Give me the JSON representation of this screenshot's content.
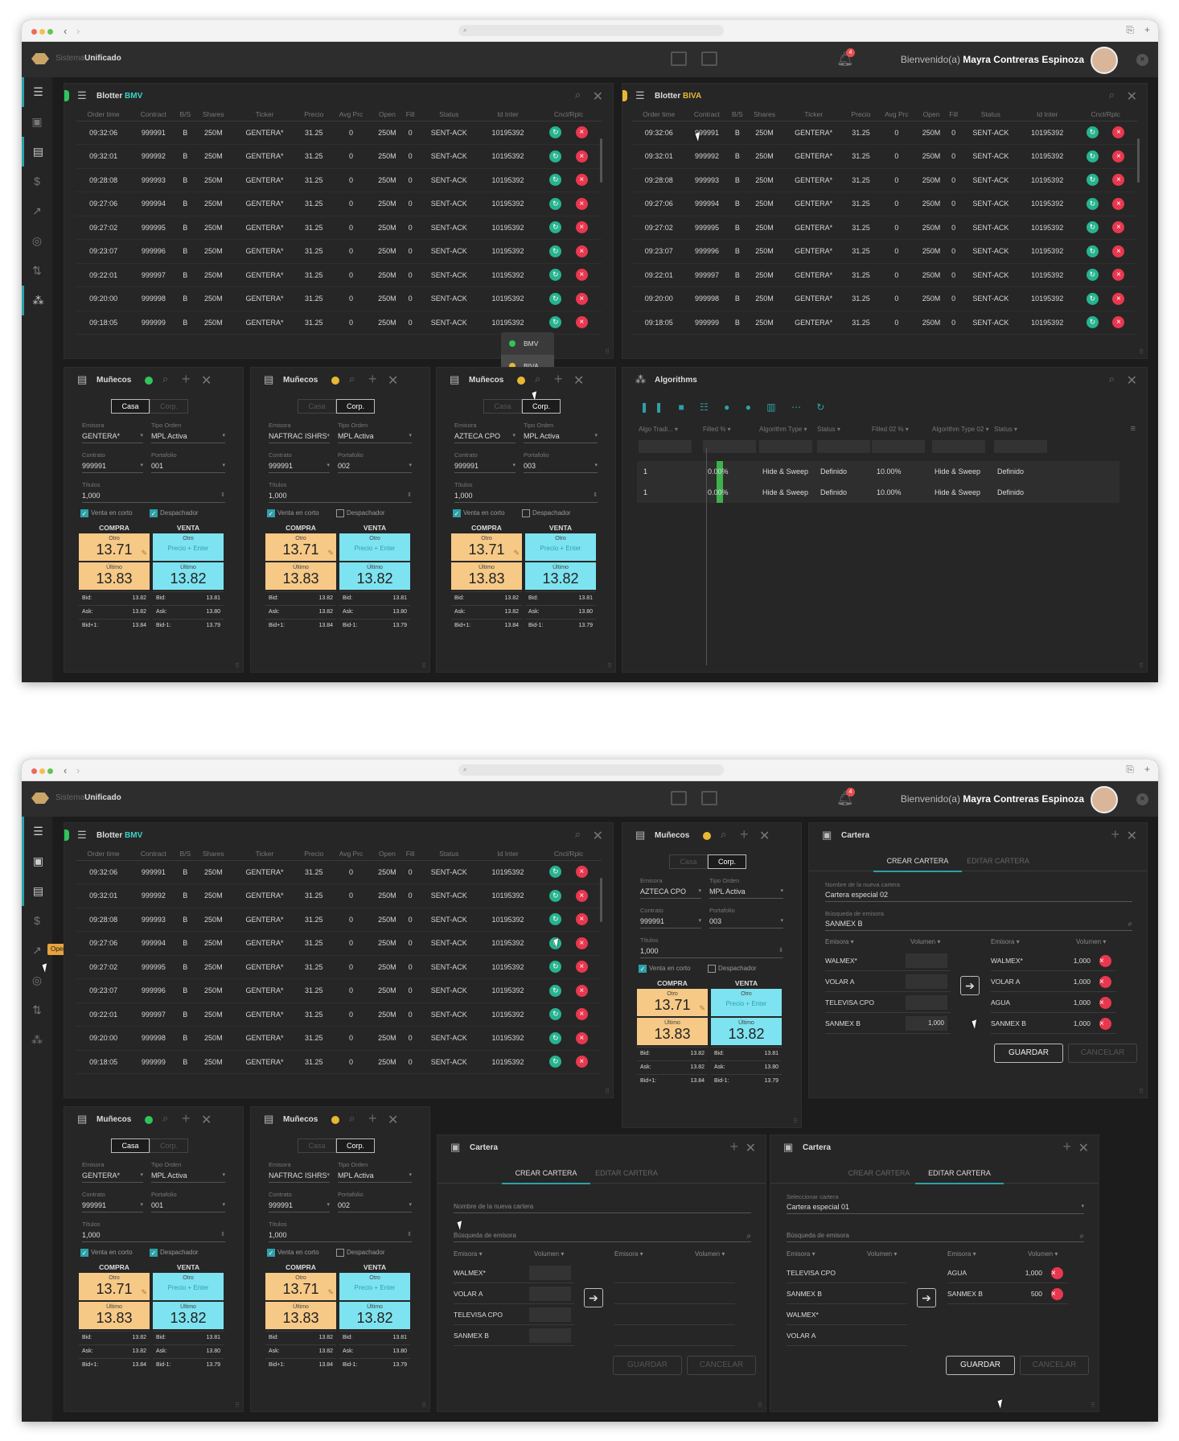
{
  "browser": {
    "back": "‹",
    "fwd": "›"
  },
  "app": {
    "brand_light": "Sistema",
    "brand_bold": "Unificado",
    "welcome": "Bienvenido(a)",
    "user": "Mayra Contreras Espinoza",
    "notif_count": "4"
  },
  "blotter": {
    "bmv_title": "Blotter",
    "bmv_tag": "BMV",
    "biva_title": "Blotter",
    "biva_tag": "BIVA",
    "cols": [
      "Order time",
      "Contract",
      "B/S",
      "Shares",
      "Ticker",
      "Precio",
      "Avg Prc",
      "Open",
      "Fill",
      "Status",
      "Id Inter",
      "Cncl/Rplc"
    ],
    "rows": [
      [
        "09:32:06",
        "999991",
        "B",
        "250M",
        "GENTERA*",
        "31.25",
        "0",
        "250M",
        "0",
        "SENT-ACK",
        "10195392"
      ],
      [
        "09:32:01",
        "999992",
        "B",
        "250M",
        "GENTERA*",
        "31.25",
        "0",
        "250M",
        "0",
        "SENT-ACK",
        "10195392"
      ],
      [
        "09:28:08",
        "999993",
        "B",
        "250M",
        "GENTERA*",
        "31.25",
        "0",
        "250M",
        "0",
        "SENT-ACK",
        "10195392"
      ],
      [
        "09:27:06",
        "999994",
        "B",
        "250M",
        "GENTERA*",
        "31.25",
        "0",
        "250M",
        "0",
        "SENT-ACK",
        "10195392"
      ],
      [
        "09:27:02",
        "999995",
        "B",
        "250M",
        "GENTERA*",
        "31.25",
        "0",
        "250M",
        "0",
        "SENT-ACK",
        "10195392"
      ],
      [
        "09:23:07",
        "999996",
        "B",
        "250M",
        "GENTERA*",
        "31.25",
        "0",
        "250M",
        "0",
        "SENT-ACK",
        "10195392"
      ],
      [
        "09:22:01",
        "999997",
        "B",
        "250M",
        "GENTERA*",
        "31.25",
        "0",
        "250M",
        "0",
        "SENT-ACK",
        "10195392"
      ],
      [
        "09:20:00",
        "999998",
        "B",
        "250M",
        "GENTERA*",
        "31.25",
        "0",
        "250M",
        "0",
        "SENT-ACK",
        "10195392"
      ],
      [
        "09:18:05",
        "999999",
        "B",
        "250M",
        "GENTERA*",
        "31.25",
        "0",
        "250M",
        "0",
        "SENT-ACK",
        "10195392"
      ]
    ]
  },
  "market_popup": {
    "bmv": "BMV",
    "biva": "BIVA"
  },
  "muneco": {
    "title": "Muñecos",
    "casa": "Casa",
    "corp": "Corp.",
    "lbl_emisora": "Emisora",
    "lbl_tipo": "Tipo Orden",
    "lbl_contrato": "Contrato",
    "lbl_port": "Portafolio",
    "lbl_titulos": "Títulos",
    "tipo": "MPL Activa",
    "contrato": "999991",
    "titulos": "1,000",
    "venta_corto": "Venta en corto",
    "despachador": "Despachador",
    "compra": "COMPRA",
    "venta": "VENTA",
    "otro": "Otro",
    "ultimo": "Último",
    "buy_otro": "13.71",
    "buy_ult": "13.83",
    "sell_hint": "Precio + Enter",
    "sell_ult": "13.82",
    "bid_l": "Bid:",
    "ask_l": "Ask:",
    "bid1_l": "Bid+1:",
    "bidm1_l": "Bid-1:",
    "c_bid": "13.82",
    "c_ask": "13.82",
    "c_bid1": "13.84",
    "v_bid": "13.81",
    "v_ask": "13.80",
    "v_bidm1": "13.79",
    "a": {
      "emisora": "GENTERA*",
      "port": "001"
    },
    "b": {
      "emisora": "NAFTRAC ISHRS",
      "port": "002"
    },
    "c": {
      "emisora": "AZTECA CPO",
      "port": "003"
    }
  },
  "algos": {
    "title": "Algorithms",
    "cols": [
      "Algo Tradi...",
      "Filled %",
      "Algorithm Type",
      "Status",
      "Filled 02 %",
      "Algorithm Type 02",
      "Status"
    ],
    "rows": [
      [
        "1",
        "0.00%",
        "Hide & Sweep",
        "Definido",
        "10.00%",
        "Hide & Sweep",
        "Definido"
      ],
      [
        "1",
        "0.00%",
        "Hide & Sweep",
        "Definido",
        "10.00%",
        "Hide & Sweep",
        "Definido"
      ]
    ]
  },
  "tooltip": "Operación",
  "cartera": {
    "title": "Cartera",
    "tab_crear": "CREAR CARTERA",
    "tab_editar": "EDITAR CARTERA",
    "lbl_nombre": "Nombre de la nueva cartera",
    "nombre": "Cartera especial 02",
    "lbl_busq": "Búsqueda de emisora",
    "busq": "SANMEX B",
    "lbl_sel": "Seleccionar cartera",
    "sel": "Cartera especial 01",
    "col_emisora": "Emisora",
    "col_vol": "Volumen",
    "left": [
      "WALMEX*",
      "VOLAR A",
      "TELEVISA CPO",
      "SANMEX B"
    ],
    "left_vol": "1,000",
    "right": [
      [
        "WALMEX*",
        "1,000"
      ],
      [
        "VOLAR A",
        "1,000"
      ],
      [
        "AGUA",
        "1,000"
      ],
      [
        "SANMEX B",
        "1,000"
      ]
    ],
    "edit_left": [
      "TELEVISA CPO",
      "SANMEX B",
      "WALMEX*",
      "VOLAR A"
    ],
    "edit_right": [
      [
        "AGUA",
        "1,000"
      ],
      [
        "SANMEX B",
        "500"
      ]
    ],
    "guardar": "GUARDAR",
    "cancelar": "CANCELAR"
  },
  "colors": {
    "accent": "#2ea0a8",
    "gold": "#e8b833",
    "teal": "#3ad2c6",
    "red": "#e8384f",
    "green": "#27b38f"
  }
}
